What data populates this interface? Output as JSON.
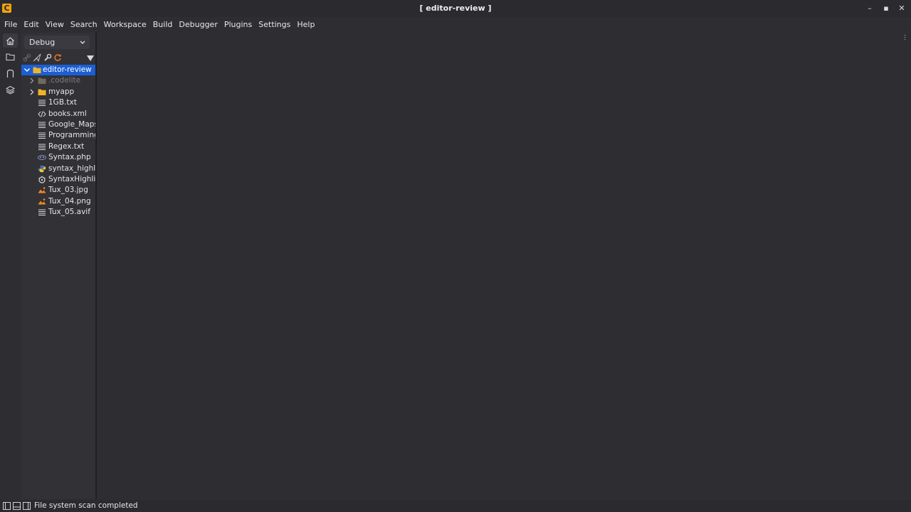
{
  "window": {
    "title": "[ editor-review ]",
    "app_logo": "C",
    "controls": {
      "minimize": "–",
      "maximize": "▪",
      "close": "✕"
    }
  },
  "menu": [
    "File",
    "Edit",
    "View",
    "Search",
    "Workspace",
    "Build",
    "Debugger",
    "Plugins",
    "Settings",
    "Help"
  ],
  "activity_bar": [
    "home-icon",
    "folder-icon",
    "magnet-icon",
    "layers-icon"
  ],
  "side_panel": {
    "config": "Debug",
    "toolbar_icons": [
      "link-icon",
      "send-icon",
      "wrench-icon",
      "refresh-icon",
      "filter-icon"
    ],
    "tree": {
      "root": "editor-review",
      "items": [
        {
          "label": ".codelite",
          "icon": "folder-icon",
          "expandable": true,
          "dim": true
        },
        {
          "label": "myapp",
          "icon": "folder-icon",
          "expandable": true,
          "dim": false
        },
        {
          "label": "1GB.txt",
          "icon": "text-file-icon"
        },
        {
          "label": "books.xml",
          "icon": "code-file-icon"
        },
        {
          "label": "Google_Maps_",
          "icon": "text-file-icon"
        },
        {
          "label": "Programming(",
          "icon": "text-file-icon"
        },
        {
          "label": "Regex.txt",
          "icon": "text-file-icon"
        },
        {
          "label": "Syntax.php",
          "icon": "php-file-icon"
        },
        {
          "label": "syntax_highlig",
          "icon": "python-file-icon"
        },
        {
          "label": "SyntaxHighlig",
          "icon": "rust-file-icon"
        },
        {
          "label": "Tux_03.jpg",
          "icon": "image-file-icon"
        },
        {
          "label": "Tux_04.png",
          "icon": "image-file-icon"
        },
        {
          "label": "Tux_05.avif",
          "icon": "text-file-icon"
        }
      ]
    }
  },
  "status": {
    "text": "File system scan completed"
  },
  "colors": {
    "accent": "#1c5fd4",
    "folder": "#f0b429",
    "logo": "#f0a20f"
  }
}
